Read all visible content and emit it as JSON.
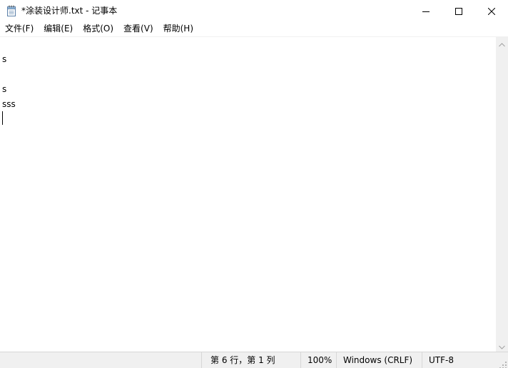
{
  "window": {
    "title": "*涂装设计师.txt - 记事本",
    "icon": "notepad-icon"
  },
  "controls": {
    "minimize_icon": "minimize-icon",
    "maximize_icon": "maximize-icon",
    "close_icon": "close-icon"
  },
  "menu": {
    "items": [
      {
        "label": "文件(F)"
      },
      {
        "label": "编辑(E)"
      },
      {
        "label": "格式(O)"
      },
      {
        "label": "查看(V)"
      },
      {
        "label": "帮助(H)"
      }
    ]
  },
  "editor": {
    "lines": [
      "",
      "s",
      "",
      "s",
      "sss",
      ""
    ]
  },
  "status": {
    "position": "第 6 行，第 1 列",
    "zoom": "100%",
    "line_ending": "Windows (CRLF)",
    "encoding": "UTF-8"
  }
}
